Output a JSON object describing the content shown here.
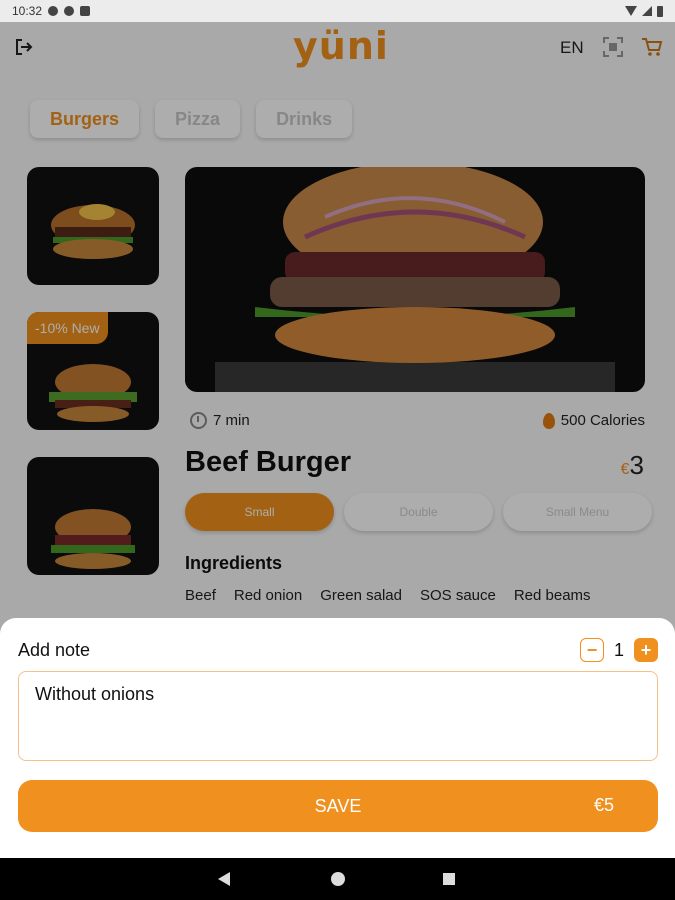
{
  "status_bar": {
    "time": "10:32",
    "icons": [
      "gear-icon",
      "a-icon",
      "sd-card-icon"
    ],
    "right_icons": [
      "wifi-icon",
      "signal-icon",
      "battery-icon"
    ]
  },
  "header": {
    "logo": "yüni",
    "language": "EN",
    "icons": [
      "logout-icon",
      "scan-icon",
      "cart-icon"
    ]
  },
  "tabs": [
    {
      "label": "Burgers",
      "active": true
    },
    {
      "label": "Pizza",
      "active": false
    },
    {
      "label": "Drinks",
      "active": false
    }
  ],
  "thumbnails": [
    {
      "badge": ""
    },
    {
      "badge": "-10% New"
    },
    {
      "badge": ""
    }
  ],
  "product": {
    "time": "7 min",
    "calories": "500 Calories",
    "name": "Beef Burger",
    "currency": "€",
    "price": "3",
    "sizes": [
      {
        "label": "Small",
        "active": true
      },
      {
        "label": "Double",
        "active": false
      },
      {
        "label": "Small Menu",
        "active": false
      }
    ],
    "ingredients_title": "Ingredients",
    "ingredients": [
      "Beef",
      "Red onion",
      "Green salad",
      "SOS sauce",
      "Red beams"
    ]
  },
  "sheet": {
    "note_label": "Add note",
    "quantity": "1",
    "minus": "−",
    "plus": "+",
    "note_value": "Without onions",
    "save_label": "SAVE",
    "save_price": "€5"
  },
  "colors": {
    "accent": "#f0901e"
  }
}
